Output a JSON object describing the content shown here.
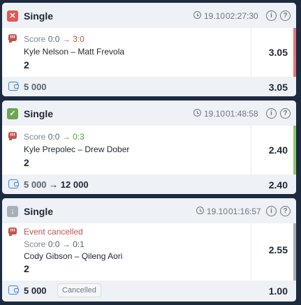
{
  "bets": [
    {
      "status": "lost",
      "status_glyph": "✕",
      "status_color": "#e05a55",
      "side_color": "#e3767a",
      "title": "Single",
      "date": "19.10",
      "time": "02:27:30",
      "cancel_text": "",
      "score_label": "Score",
      "score_from": "0:0",
      "score_arrow": "→",
      "score_to": "3:0",
      "score_to_color": "#c0534d",
      "event": "Kyle Nelson – Matt Frevola",
      "selection": "2",
      "odds": "3.05",
      "stake": "5 000",
      "stake_arrow": "",
      "payout": "",
      "cancel_pill": "",
      "total_odds": "3.05"
    },
    {
      "status": "won",
      "status_glyph": "✓",
      "status_color": "#6aa84f",
      "side_color": "#8cc96b",
      "title": "Single",
      "date": "19.10",
      "time": "01:48:58",
      "cancel_text": "",
      "score_label": "Score",
      "score_from": "0:0",
      "score_arrow": "→",
      "score_to": "0:3",
      "score_to_color": "#5e9c3f",
      "event": "Kyle Prepolec – Drew Dober",
      "selection": "2",
      "odds": "2.40",
      "stake": "5 000",
      "stake_arrow": "→",
      "payout": "12 000",
      "cancel_pill": "",
      "total_odds": "2.40"
    },
    {
      "status": "returned",
      "status_glyph": "↓",
      "status_color": "#a7afba",
      "side_color": "#a7afba",
      "title": "Single",
      "date": "19.10",
      "time": "01:16:57",
      "cancel_text": "Event cancelled",
      "score_label": "Score",
      "score_from": "0:0",
      "score_arrow": "→",
      "score_to": "0:1",
      "score_to_color": "#5b6573",
      "event": "Cody Gibson – Qileng Aori",
      "selection": "2",
      "odds": "2.55",
      "stake": "5 000",
      "stake_arrow": "",
      "payout": "",
      "cancel_pill": "Cancelled",
      "total_odds": "1.00"
    }
  ],
  "icons": {
    "clock": "clock-icon",
    "info": "info-icon",
    "help": "help-icon",
    "sport": "mma-glove-icon",
    "wallet": "wallet-icon"
  },
  "info_glyph": "i",
  "help_glyph": "?"
}
